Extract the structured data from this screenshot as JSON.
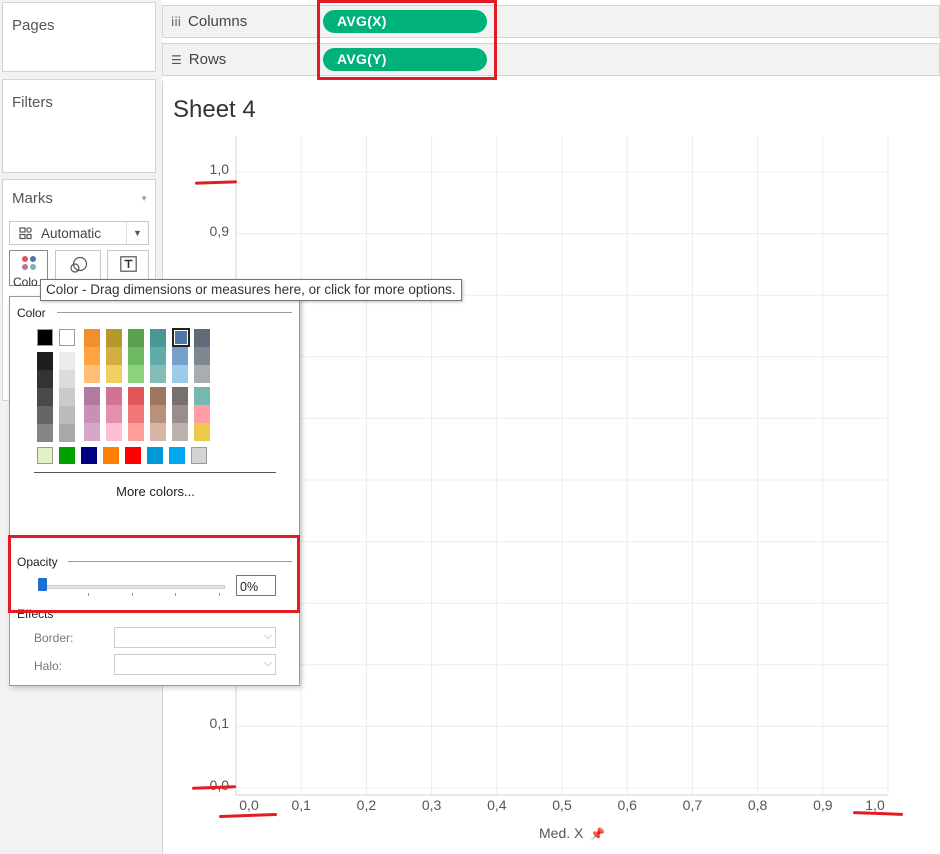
{
  "cards": {
    "pages": "Pages",
    "filters": "Filters",
    "marks": "Marks",
    "marks_type": "Automatic",
    "color_button_label": "Colo"
  },
  "shelves": {
    "columns": {
      "label": "Columns",
      "pill": "AVG(X)"
    },
    "rows": {
      "label": "Rows",
      "pill": "AVG(Y)"
    }
  },
  "sheet": {
    "title": "Sheet 4"
  },
  "tooltip": "Color - Drag dimensions or measures here, or click for more options.",
  "color_panel": {
    "color_title": "Color",
    "more_colors": "More colors...",
    "opacity_title": "Opacity",
    "opacity_value": "0%",
    "opacity_level": 0,
    "effects_title": "Effects",
    "border_label": "Border:",
    "halo_label": "Halo:",
    "palette": {
      "bw": [
        "#000000",
        "#ffffff"
      ],
      "grays": [
        [
          "#1e1e1e",
          "#333333",
          "#4a4a4a",
          "#666666",
          "#858585"
        ],
        [
          "#ececec",
          "#dcdcdc",
          "#cbcbcb",
          "#bbbbbb",
          "#a8a8a8"
        ]
      ],
      "top_columns": [
        [
          "#f28e2b",
          "#ffa443",
          "#ffbf79"
        ],
        [
          "#b6992d",
          "#d4ae45",
          "#f1ce63"
        ],
        [
          "#59a14f",
          "#6fb862",
          "#8cd17d"
        ],
        [
          "#499894",
          "#5fada9",
          "#86bcb6"
        ],
        [
          "#4e79a7",
          "#76a0c9",
          "#a0cbe8"
        ],
        [
          "#5f6b7a",
          "#7d8791",
          "#a8adb3"
        ]
      ],
      "bottom_columns": [
        [
          "#b07aa1",
          "#c98fb4",
          "#d4a6c8"
        ],
        [
          "#d37295",
          "#e58fae",
          "#fabfd2"
        ],
        [
          "#e15759",
          "#f07678",
          "#ff9d9a"
        ],
        [
          "#9d7660",
          "#b8917c",
          "#d7b5a6"
        ],
        [
          "#79706e",
          "#988f8c",
          "#bab0ac"
        ],
        [
          "#76b7b2",
          "#ff9da7",
          "#edc948"
        ]
      ],
      "bright_row": [
        "#e2f2c6",
        "#00a100",
        "#000080",
        "#ff8000",
        "#ff0000",
        "#0098d8",
        "#00a6f0",
        "#d4d4d4"
      ]
    }
  },
  "chart_data": {
    "type": "scatter",
    "xlabel": "Med. X",
    "ylabel": "",
    "xlim": [
      0,
      1
    ],
    "ylim": [
      0,
      1
    ],
    "x_ticks": [
      "0,0",
      "0,1",
      "0,2",
      "0,3",
      "0,4",
      "0,5",
      "0,6",
      "0,7",
      "0,8",
      "0,9",
      "1,0"
    ],
    "y_ticks_visible": [
      "1,0",
      "0,9",
      "0,1",
      "0,0"
    ],
    "grid": true,
    "points": []
  }
}
